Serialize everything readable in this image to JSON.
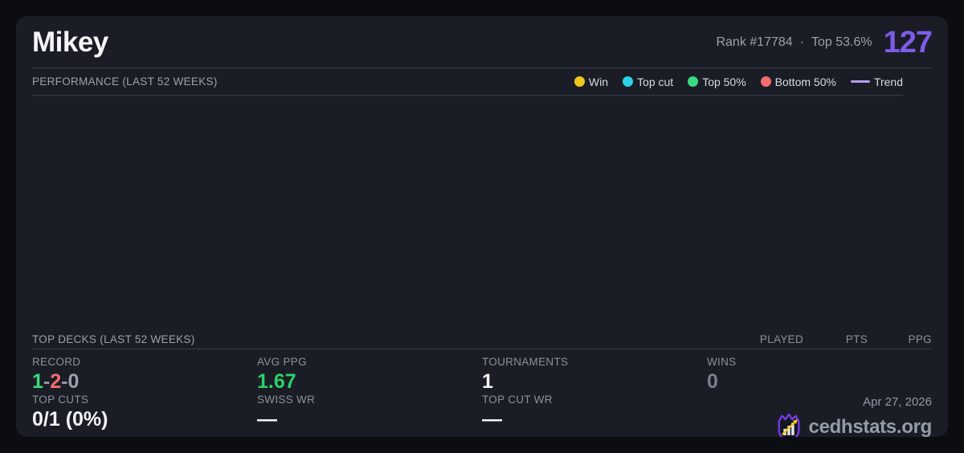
{
  "header": {
    "player_name": "Mikey",
    "rank_text": "Rank #17784",
    "separator": "·",
    "percentile_text": "Top 53.6%",
    "score": "127"
  },
  "performance": {
    "title": "PERFORMANCE (LAST 52 WEEKS)",
    "legend": {
      "items": [
        {
          "label": "Win",
          "color": "#edc61e",
          "swatch": "dot"
        },
        {
          "label": "Top cut",
          "color": "#2ed0e8",
          "swatch": "dot"
        },
        {
          "label": "Top 50%",
          "color": "#3bd97f",
          "swatch": "dot"
        },
        {
          "label": "Bottom 50%",
          "color": "#f36d6d",
          "swatch": "dot"
        },
        {
          "label": "Trend",
          "color": "#b29df2",
          "swatch": "line"
        }
      ]
    }
  },
  "top_decks": {
    "title": "TOP DECKS (LAST 52 WEEKS)",
    "columns": [
      "PLAYED",
      "PTS",
      "PPG"
    ]
  },
  "stats": {
    "record": {
      "label": "RECORD",
      "parts": [
        {
          "text": "1",
          "color": "#3eda79"
        },
        {
          "text": "-",
          "color": "#8f96a3"
        },
        {
          "text": "2",
          "color": "#f36d6d"
        },
        {
          "text": "-",
          "color": "#8f96a3"
        },
        {
          "text": "0",
          "color": "#9aa1ad"
        }
      ]
    },
    "avg_ppg": {
      "label": "AVG PPG",
      "value": "1.67",
      "color": "#2ed167"
    },
    "tournaments": {
      "label": "TOURNAMENTS",
      "value": "1",
      "color": "#f2f3f5"
    },
    "wins": {
      "label": "WINS",
      "value": "0",
      "color": "#79808f"
    },
    "top_cuts": {
      "label": "TOP CUTS",
      "value": "0/1 (0%)",
      "color": "#f2f3f5"
    },
    "swiss_wr": {
      "label": "SWISS WR",
      "value": "—",
      "color": "#f2f3f5"
    },
    "top_cut_wr": {
      "label": "TOP CUT WR",
      "value": "—",
      "color": "#f2f3f5"
    }
  },
  "footer": {
    "date": "Apr 27, 2026",
    "brand": "cedhstats.org"
  },
  "colors": {
    "accent_purple": "#7d5ce8",
    "trend_purple": "#b29df2",
    "card_bg": "#1a1d26",
    "page_bg": "#0c0d11",
    "positive_green": "#3eda79",
    "negative_red": "#f36d6d"
  }
}
